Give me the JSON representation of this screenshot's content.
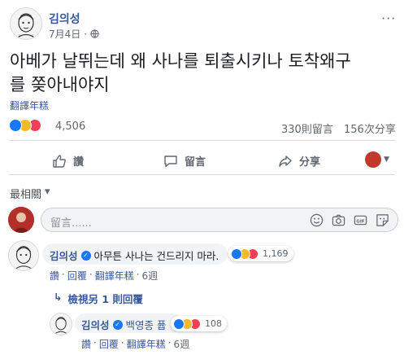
{
  "post": {
    "author": "김의성",
    "date": "7月4日",
    "separator": "·",
    "text_line1": "아베가 날뛰는데 왜 사나를 퇴출시키나 토착왜구",
    "text_line2": "를 쫒아내야지",
    "translate": "翻譯年糕",
    "reaction_count": "4,506",
    "comment_count": "330則留言",
    "share_count": "156次分享"
  },
  "actions": {
    "like": "讚",
    "comment": "留言",
    "share": "分享"
  },
  "filter": {
    "label": "最相關",
    "chevron": "▾"
  },
  "composer": {
    "placeholder": "留言......"
  },
  "comment1": {
    "author": "김의성",
    "text": "아무튼 사나는 건드리지 마라.",
    "reaction_count": "1,169",
    "like": "讚",
    "reply": "回覆",
    "translate": "翻譯年糕",
    "time": "6週",
    "sep": "·",
    "more_replies": "檢視另 1 則回覆",
    "more_arrow": "↳"
  },
  "reply1": {
    "author": "김의성",
    "text": "백영종 퓹",
    "reaction_count": "108",
    "like": "讚",
    "reply": "回覆",
    "translate": "翻譯年糕",
    "time": "6週",
    "sep": "·"
  },
  "colors": {
    "link": "#385898",
    "like_blue": "#1877f2",
    "haha_yellow": "#f7b928",
    "love_red": "#f33e58"
  }
}
